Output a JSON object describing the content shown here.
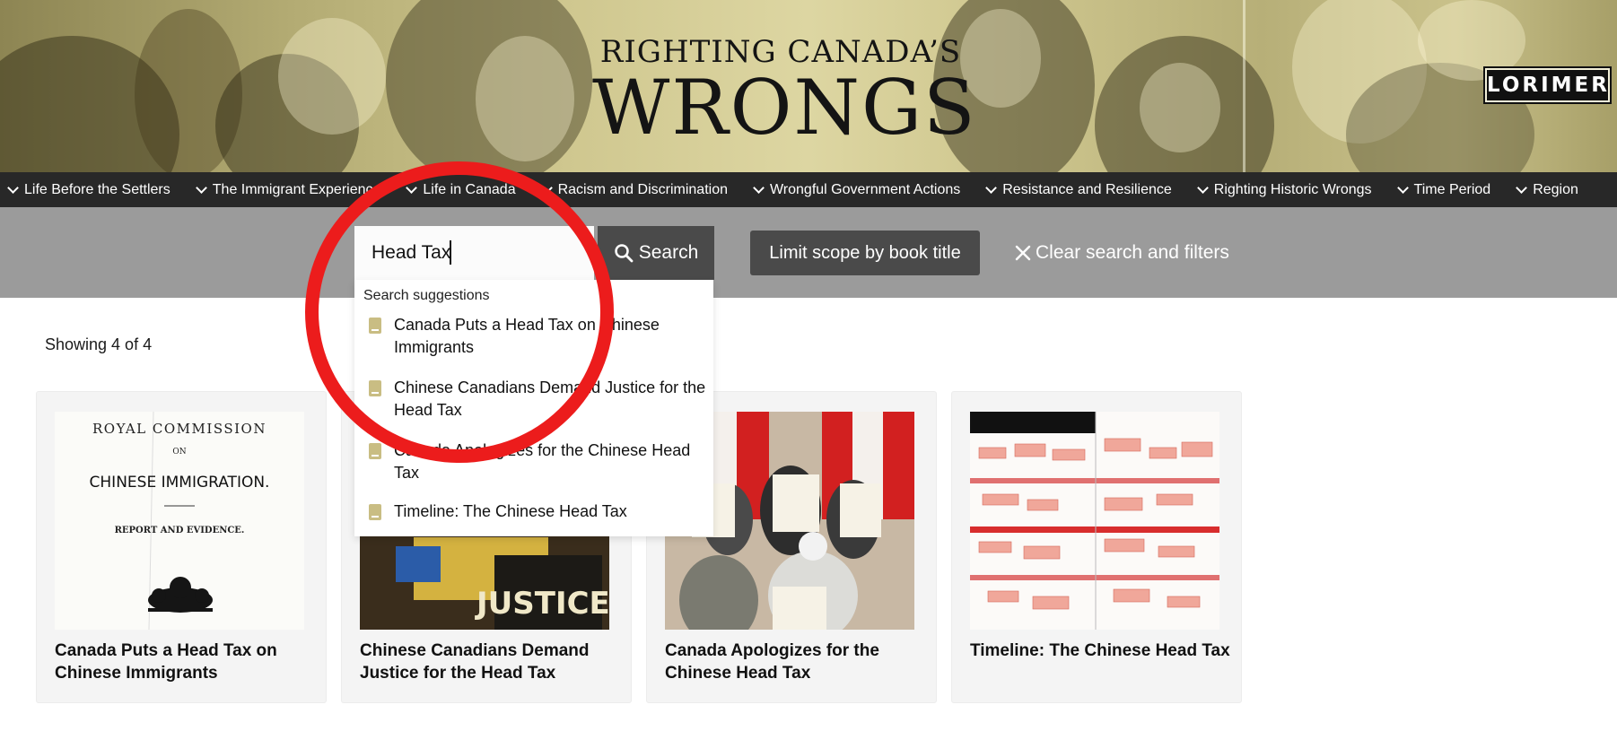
{
  "site": {
    "title_line1": "RIGHTING CANADA’S",
    "title_line2": "WRONGS",
    "publisher_logo": "LORIMER"
  },
  "nav": {
    "items": [
      {
        "label": "Life Before the Settlers"
      },
      {
        "label": "The Immigrant Experience"
      },
      {
        "label": "Life in Canada"
      },
      {
        "label": "Racism and Discrimination"
      },
      {
        "label": "Wrongful Government Actions"
      },
      {
        "label": "Resistance and Resilience"
      },
      {
        "label": "Righting Historic Wrongs"
      },
      {
        "label": "Time Period"
      },
      {
        "label": "Region"
      }
    ]
  },
  "search": {
    "value": "Head Tax",
    "button_label": "Search",
    "scope_label": "Limit scope by book title",
    "clear_label": "Clear search and filters"
  },
  "suggestions": {
    "heading": "Search suggestions",
    "items": [
      {
        "label": "Canada Puts a Head Tax on Chinese Immigrants"
      },
      {
        "label": "Chinese Canadians Demand Justice for the Head Tax"
      },
      {
        "label": "Canada Apologizes for the Chinese Head Tax"
      },
      {
        "label": "Timeline: The Chinese Head Tax"
      }
    ]
  },
  "results": {
    "showing": "Showing 4 of 4",
    "cards": [
      {
        "title": "Canada Puts a Head Tax on Chinese Immigrants",
        "thumb_text": [
          "ROYAL COMMISSION",
          "ON",
          "CHINESE IMMIGRATION.",
          "REPORT AND EVIDENCE."
        ]
      },
      {
        "title": "Chinese Canadians Demand Justice for the Head Tax",
        "thumb_text": [
          "JUSTICE"
        ]
      },
      {
        "title": "Canada Apologizes for the Chinese Head Tax"
      },
      {
        "title": "Timeline: The Chinese Head Tax"
      }
    ]
  },
  "colors": {
    "nav_bg": "#282828",
    "search_band": "#9b9b9b",
    "button_bg": "#4a4a4a",
    "highlight_ring": "#ec1c1c",
    "book_icon": "#c9bd83"
  }
}
